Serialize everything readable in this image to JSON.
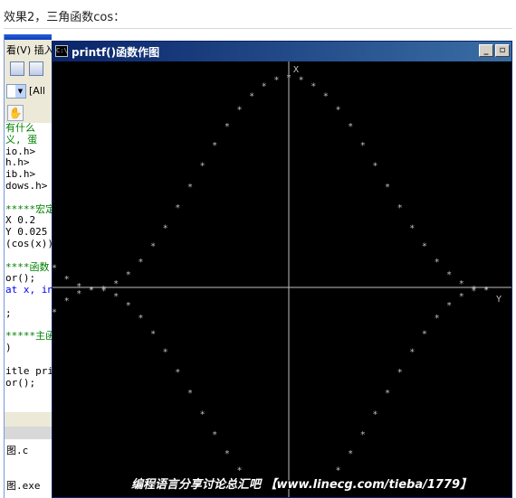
{
  "caption": "效果2，三角函数cos：",
  "ide": {
    "menu_text": "看(V)  插入",
    "combo_value": "[All",
    "code_lines": [
      {
        "text": "有什么",
        "color": "green"
      },
      {
        "text": "义, 蛋",
        "color": "green"
      },
      {
        "text": "io.h>",
        "color": "black"
      },
      {
        "text": "h.h>",
        "color": "black"
      },
      {
        "text": "ib.h>",
        "color": "black"
      },
      {
        "text": "dows.h>",
        "color": "black"
      },
      {
        "text": "",
        "color": "black"
      },
      {
        "text": "*****宏定",
        "color": "green"
      },
      {
        "text": "X 0.2",
        "color": "black"
      },
      {
        "text": "Y 0.025",
        "color": "black"
      },
      {
        "text": "(cos(x))",
        "color": "black"
      },
      {
        "text": "",
        "color": "black"
      },
      {
        "text": "****函数",
        "color": "green"
      },
      {
        "text": "or();",
        "color": "black"
      },
      {
        "text": "at x, in",
        "color": "blue"
      },
      {
        "text": "",
        "color": "black"
      },
      {
        "text": ";",
        "color": "black"
      },
      {
        "text": "",
        "color": "black"
      },
      {
        "text": "*****主函",
        "color": "green"
      },
      {
        "text": ")",
        "color": "black"
      },
      {
        "text": "",
        "color": "black"
      },
      {
        "text": "itle pri",
        "color": "black"
      },
      {
        "text": "or();",
        "color": "black"
      }
    ],
    "files": [
      "图.c",
      "图.exe"
    ]
  },
  "console": {
    "title": "printf()函数作图",
    "min_label": "_",
    "max_label": "🗗",
    "icon_text": "C:\\",
    "axis_x_label": "X",
    "axis_y_label": "Y",
    "point_char": "*"
  },
  "watermark": "编程语言分享讨论总汇吧 【www.linecg.com/tieba/1779】",
  "chart_data": {
    "type": "scatter",
    "title": "",
    "description_of_series": "cos(x) plotted with '*' characters",
    "x": [
      -3.8,
      -3.6,
      -3.4,
      -3.2,
      -3.0,
      -2.8,
      -2.6,
      -2.4,
      -2.2,
      -2.0,
      -1.8,
      -1.6,
      -1.4,
      -1.2,
      -1.0,
      -0.8,
      -0.6,
      -0.4,
      -0.2,
      0.0,
      0.2,
      0.4,
      0.6,
      0.8,
      1.0,
      1.2,
      1.4,
      1.6,
      1.8,
      2.0,
      2.2,
      2.4,
      2.6,
      2.8,
      3.0,
      3.2
    ],
    "ylim": [
      -1,
      1
    ]
  },
  "colors": {
    "console_bg": "#000000",
    "foreground": "#c0c0c0",
    "titlebar_start": "#0a246a",
    "titlebar_end": "#3a6ea5"
  }
}
